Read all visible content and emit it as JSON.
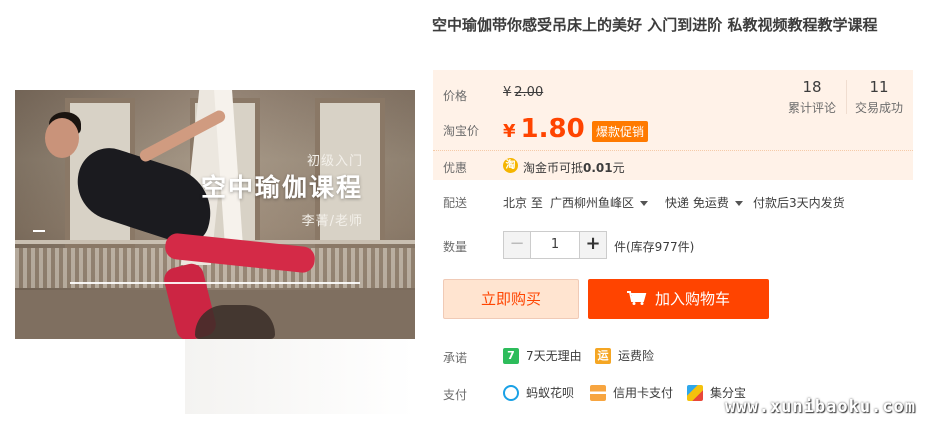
{
  "product": {
    "title": "空中瑜伽带你感受吊床上的美好 入门到进阶 私教视频教程教学课程",
    "image": {
      "subtitle": "初级入门",
      "headline": "空中瑜伽课程",
      "author": "李菁/老师"
    }
  },
  "price_panel": {
    "price_label": "价格",
    "original_price_currency": "¥",
    "original_price": "2.00",
    "promo_label": "淘宝价",
    "promo_price_currency": "¥",
    "promo_price": "1.80",
    "promo_badge": "爆款促销",
    "stats": [
      {
        "value": "18",
        "label": "累计评论"
      },
      {
        "value": "11",
        "label": "交易成功"
      }
    ],
    "discount_label": "优惠",
    "coupon_icon_text": "淘",
    "coupon_text_prefix": "淘金币可抵",
    "coupon_amount": "0.01",
    "coupon_text_suffix": "元"
  },
  "delivery": {
    "label": "配送",
    "from": "北京 至",
    "to": "广西柳州鱼峰区",
    "method": "快递 免运费",
    "ship_time": "付款后3天内发货"
  },
  "quantity": {
    "label": "数量",
    "minus": "−",
    "value": "1",
    "plus": "+",
    "stock_text": "件(库存977件)"
  },
  "actions": {
    "buy_now": "立即购买",
    "add_to_cart": "加入购物车"
  },
  "promise": {
    "label": "承诺",
    "items": [
      {
        "icon": "seven-day-return-icon",
        "glyph": "7",
        "text": "7天无理由"
      },
      {
        "icon": "freight-insurance-icon",
        "glyph": "运",
        "text": "运费险"
      }
    ]
  },
  "payment": {
    "label": "支付",
    "items": [
      {
        "icon": "huabei-icon",
        "text": "蚂蚁花呗"
      },
      {
        "icon": "credit-card-icon",
        "text": "信用卡支付"
      },
      {
        "icon": "jifenbao-icon",
        "text": "集分宝"
      }
    ]
  },
  "watermark": "www.xunibaoku.com",
  "colors": {
    "accent": "#ff4400",
    "panel_bg": "#fff2e8",
    "badge": "#ff7a00"
  }
}
